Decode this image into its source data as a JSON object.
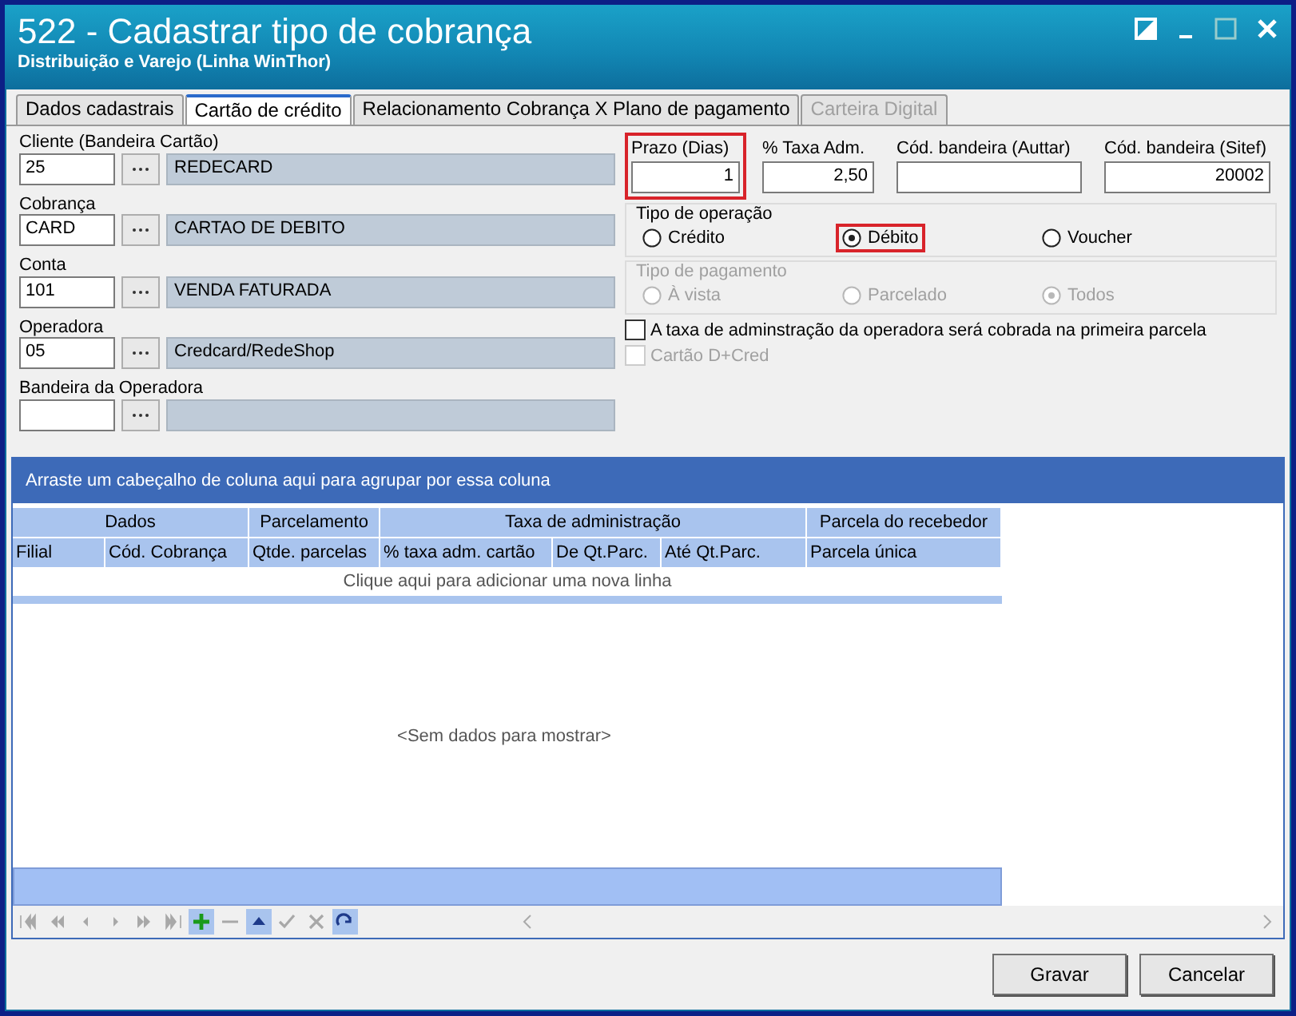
{
  "window": {
    "title": "522 - Cadastrar tipo de cobrança",
    "subtitle": "Distribuição e Varejo (Linha WinThor)"
  },
  "tabs": [
    {
      "label": "Dados cadastrais",
      "selected": false,
      "disabled": false
    },
    {
      "label": "Cartão de crédito",
      "selected": true,
      "disabled": false
    },
    {
      "label": "Relacionamento Cobrança X Plano de pagamento",
      "selected": false,
      "disabled": false
    },
    {
      "label": "Carteira Digital",
      "selected": false,
      "disabled": true
    }
  ],
  "lookups": [
    {
      "label": "Cliente (Bandeira Cartão)",
      "code": "25",
      "description": "REDECARD"
    },
    {
      "label": "Cobrança",
      "code": "CARD",
      "description": "CARTAO DE DEBITO"
    },
    {
      "label": "Conta",
      "code": "101",
      "description": "VENDA FATURADA"
    },
    {
      "label": "Operadora",
      "code": "05",
      "description": "Credcard/RedeShop"
    },
    {
      "label": "Bandeira da Operadora"
    }
  ],
  "numeric_fields": [
    {
      "label": "Prazo (Dias)",
      "value": "1",
      "highlighted": true
    },
    {
      "label": "% Taxa Adm.",
      "value": "2,50",
      "highlighted": false
    },
    {
      "label": "Cód. bandeira (Auttar)",
      "highlighted": false
    },
    {
      "label": "Cód. bandeira (Sitef)",
      "value": "20002",
      "highlighted": false
    }
  ],
  "option_groups": [
    {
      "title": "Tipo de operação",
      "disabled": false,
      "options": [
        {
          "label": "Crédito",
          "selected": false,
          "highlighted": false
        },
        {
          "label": "Débito",
          "selected": true,
          "highlighted": true
        },
        {
          "label": "Voucher",
          "selected": false,
          "highlighted": false
        }
      ]
    },
    {
      "title": "Tipo de pagamento",
      "disabled": true,
      "options": [
        {
          "label": "À vista",
          "selected": false,
          "highlighted": false
        },
        {
          "label": "Parcelado",
          "selected": false,
          "highlighted": false
        },
        {
          "label": "Todos",
          "selected": true,
          "highlighted": false
        }
      ]
    }
  ],
  "checkboxes": [
    {
      "label": "A taxa de adminstração da operadora será cobrada na primeira parcela",
      "checked": false,
      "disabled": false
    },
    {
      "label": "Cartão D+Cred",
      "checked": false,
      "disabled": true
    }
  ],
  "grid": {
    "group_panel_text": "Arraste um cabeçalho de coluna aqui para agrupar por essa coluna",
    "bands": [
      {
        "label": "Dados",
        "columns": [
          "Filial",
          "Cód. Cobrança"
        ]
      },
      {
        "label": "Parcelamento",
        "columns": [
          "Qtde. parcelas"
        ]
      },
      {
        "label": "Taxa de administração",
        "columns": [
          "% taxa adm. cartão",
          "De Qt.Parc.",
          "Até Qt.Parc."
        ]
      },
      {
        "label": "Parcela do recebedor",
        "columns": [
          "Parcela única"
        ]
      }
    ],
    "new_row_text": "Clique aqui para adicionar uma nova linha",
    "empty_text": "<Sem dados para mostrar>"
  },
  "buttons": [
    "Gravar",
    "Cancelar"
  ]
}
